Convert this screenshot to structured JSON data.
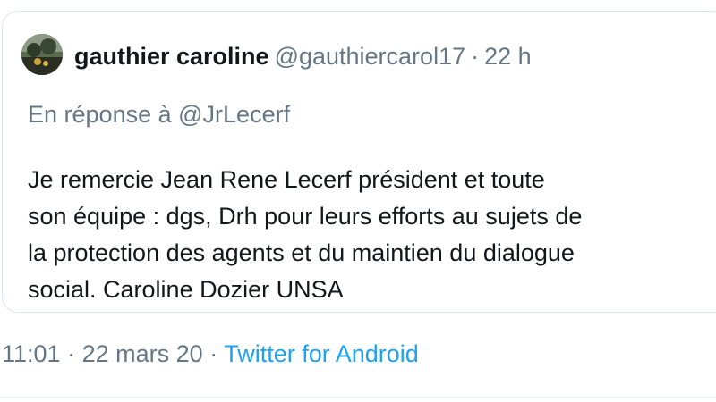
{
  "tweet": {
    "author": {
      "name": "gauthier caroline",
      "handle": "@gauthiercarol17",
      "avatar_icon": "profile-photo-avatar"
    },
    "separator": "·",
    "time_ago": "22 h",
    "reply": {
      "prefix": "En réponse à",
      "mention": "@JrLecerf"
    },
    "text_lines": [
      "Je remercie Jean Rene Lecerf président et toute",
      "son équipe : dgs, Drh pour leurs efforts au sujets de",
      "la protection des agents et du maintien du dialogue",
      "social. Caroline Dozier UNSA"
    ]
  },
  "meta": {
    "time": "11:01",
    "date": "22 mars 20",
    "separator": "·",
    "client": "Twitter for Android"
  },
  "colors": {
    "text": "#14171a",
    "secondary": "#657786",
    "link": "#1da1f2",
    "border": "#dfe5ea"
  }
}
